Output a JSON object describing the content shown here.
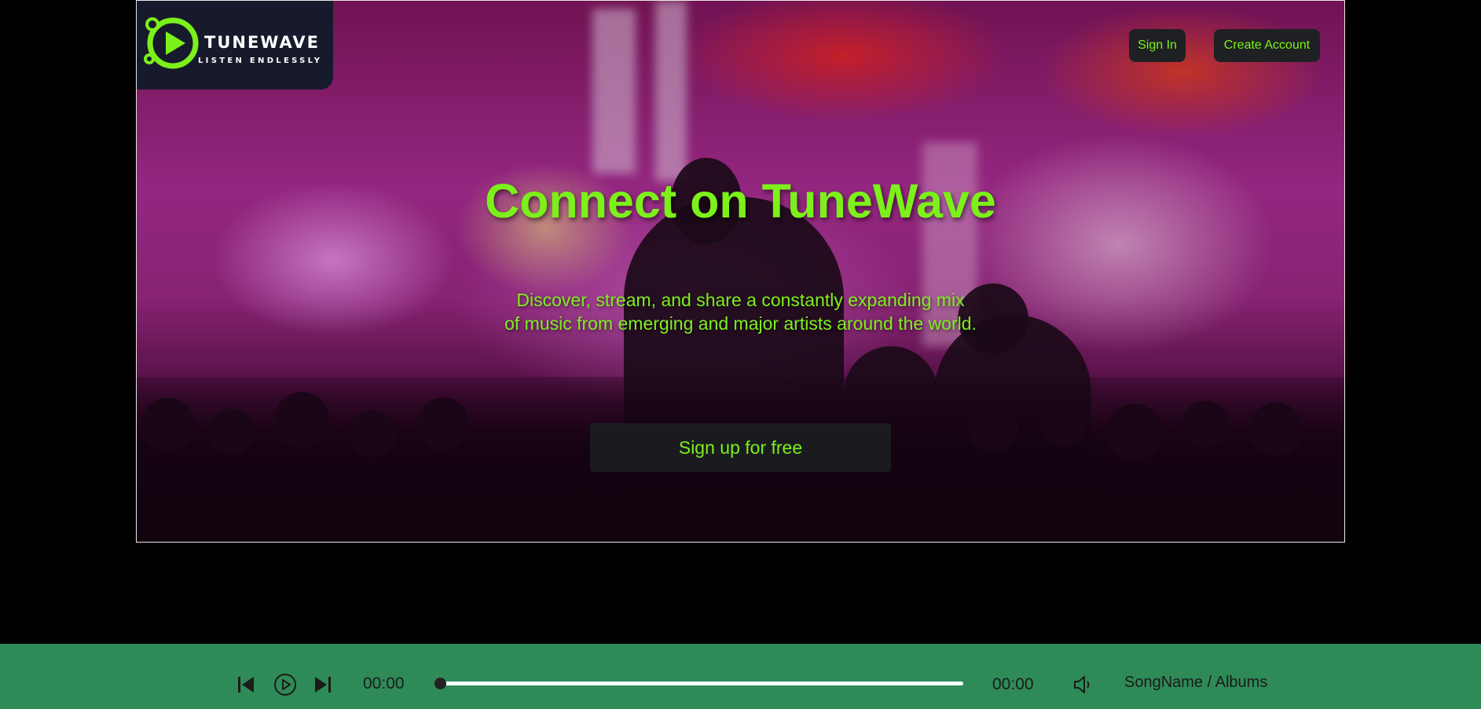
{
  "brand": {
    "name": "TUNEWAVE",
    "tagline": "LISTEN ENDLESSLY",
    "accent_color": "#7cf01a"
  },
  "nav": {
    "sign_in_label": "Sign In",
    "create_account_label": "Create Account"
  },
  "hero": {
    "title": "Connect on TuneWave",
    "subtitle_line1": "Discover, stream, and share a constantly expanding mix",
    "subtitle_line2": "of music from emerging and major artists around the world.",
    "cta_label": "Sign up for free",
    "background": "concert-crowd-photo"
  },
  "player": {
    "bar_color": "#2e8b57",
    "previous_icon": "skip-previous-icon",
    "play_icon": "play-circle-icon",
    "next_icon": "skip-next-icon",
    "volume_icon": "volume-icon",
    "current_time": "00:00",
    "duration": "00:00",
    "progress": 0,
    "now_playing": "SongName / Albums"
  }
}
